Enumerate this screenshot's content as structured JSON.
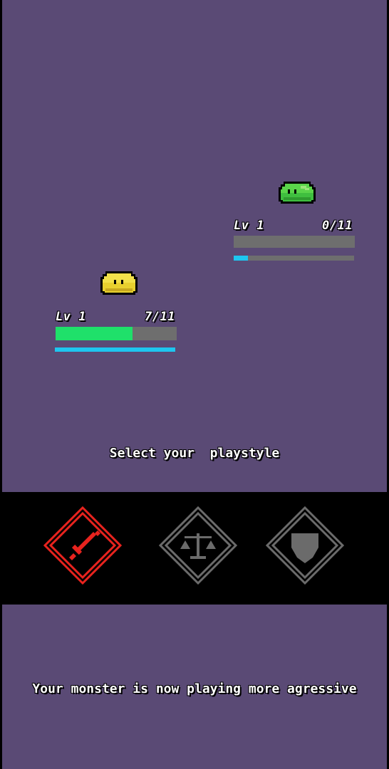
{
  "enemy": {
    "level_label": "Lv 1",
    "hp_text": "0/11",
    "hp_fraction": 0.0,
    "xp_fraction": 0.12,
    "sprite": "green-slime",
    "color": "#3fbf3f"
  },
  "player": {
    "level_label": "Lv 1",
    "hp_text": "7/11",
    "hp_fraction": 0.636,
    "xp_fraction": 1.0,
    "sprite": "yellow-slime",
    "color": "#e8d02e"
  },
  "prompt": "Select your  playstyle",
  "playstyles": [
    {
      "name": "aggressive",
      "icon": "sword-icon",
      "color": "#e8231e",
      "selected": true
    },
    {
      "name": "balanced",
      "icon": "scales-icon",
      "color": "#6b6b6b",
      "selected": false
    },
    {
      "name": "defensive",
      "icon": "shield-icon",
      "color": "#6b6b6b",
      "selected": false
    }
  ],
  "status_message": "Your monster is now playing more agressive",
  "colors": {
    "background": "#5a4a75",
    "hp_fill": "#1fe06a",
    "xp_fill": "#1ec6ef",
    "bar_empty": "#6e6e6e"
  }
}
